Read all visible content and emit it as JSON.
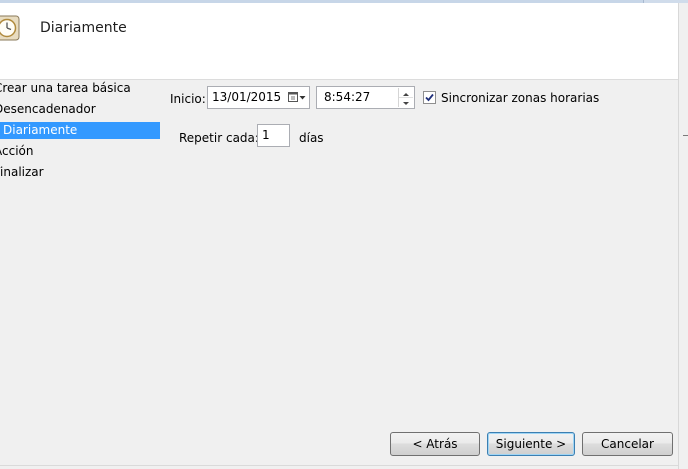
{
  "header": {
    "title": "Diariamente",
    "icon": "clock-icon"
  },
  "nav": {
    "items": [
      {
        "label": "Crear una tarea básica",
        "selected": false
      },
      {
        "label": "Desencadenador",
        "selected": false
      },
      {
        "label": "Diariamente",
        "selected": true
      },
      {
        "label": "Acción",
        "selected": false
      },
      {
        "label": "Finalizar",
        "selected": false
      }
    ]
  },
  "form": {
    "start_label": "Inicio:",
    "start_date": "13/01/2015",
    "start_time": "8:54:27",
    "sync_label": "Sincronizar zonas horarias",
    "sync_checked": true,
    "repeat_label": "Repetir cada:",
    "repeat_value": "1",
    "repeat_unit": "días"
  },
  "buttons": {
    "back": "< Atrás",
    "next": "Siguiente >",
    "cancel": "Cancelar"
  },
  "colors": {
    "selection": "#3399ff",
    "default_button_border": "#3c7fb1"
  }
}
